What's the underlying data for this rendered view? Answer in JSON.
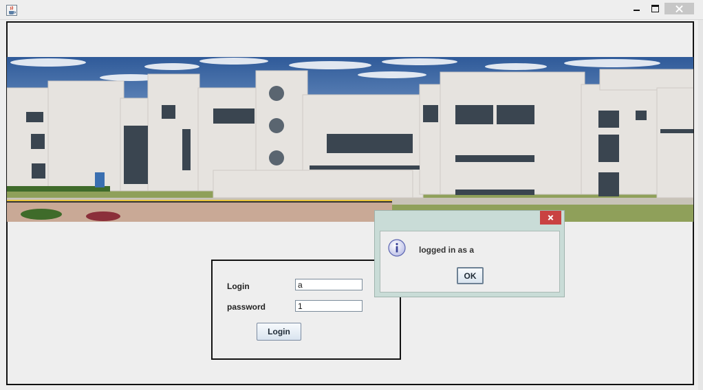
{
  "window": {
    "title": "",
    "icon": "java-cup-icon"
  },
  "banner": {
    "description_icon": "campus-building-photo"
  },
  "login_form": {
    "login_label": "Login",
    "password_label": "password",
    "login_value": "a",
    "password_value": "1",
    "login_button": "Login"
  },
  "dialog": {
    "message": "logged in as a",
    "ok_button": "OK",
    "icon": "info-icon"
  },
  "colors": {
    "dialog_frame": "#c9dcd7",
    "close_red": "#c94242",
    "background": "#eeeeee"
  }
}
